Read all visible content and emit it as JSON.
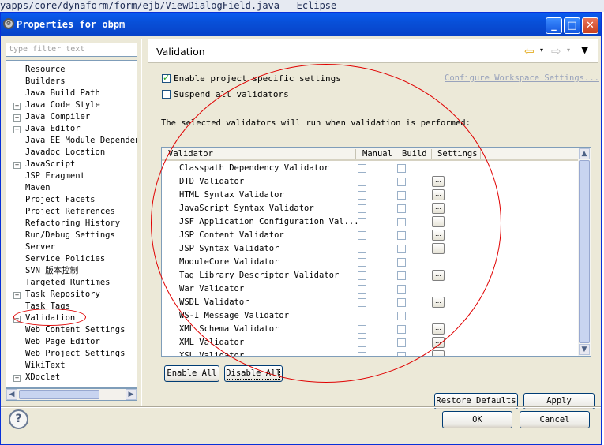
{
  "background_window": {
    "title": "yapps/core/dynaform/form/ejb/ViewDialogField.java - Eclipse"
  },
  "dialog": {
    "title": "Properties for obpm",
    "filter_placeholder": "type filter text",
    "tree": [
      {
        "label": "Resource",
        "expandable": false
      },
      {
        "label": "Builders",
        "expandable": false
      },
      {
        "label": "Java Build Path",
        "expandable": false
      },
      {
        "label": "Java Code Style",
        "expandable": true
      },
      {
        "label": "Java Compiler",
        "expandable": true
      },
      {
        "label": "Java Editor",
        "expandable": true
      },
      {
        "label": "Java EE Module Dependenc",
        "expandable": false
      },
      {
        "label": "Javadoc Location",
        "expandable": false
      },
      {
        "label": "JavaScript",
        "expandable": true
      },
      {
        "label": "JSP Fragment",
        "expandable": false
      },
      {
        "label": "Maven",
        "expandable": false
      },
      {
        "label": "Project Facets",
        "expandable": false
      },
      {
        "label": "Project References",
        "expandable": false
      },
      {
        "label": "Refactoring History",
        "expandable": false
      },
      {
        "label": "Run/Debug Settings",
        "expandable": false
      },
      {
        "label": "Server",
        "expandable": false
      },
      {
        "label": "Service Policies",
        "expandable": false
      },
      {
        "label": "SVN 版本控制",
        "expandable": false
      },
      {
        "label": "Targeted Runtimes",
        "expandable": false
      },
      {
        "label": "Task Repository",
        "expandable": true
      },
      {
        "label": "Task Tags",
        "expandable": false
      },
      {
        "label": "Validation",
        "expandable": true,
        "selected": true
      },
      {
        "label": "Web Content Settings",
        "expandable": false
      },
      {
        "label": "Web Page Editor",
        "expandable": false
      },
      {
        "label": "Web Project Settings",
        "expandable": false
      },
      {
        "label": "WikiText",
        "expandable": false
      },
      {
        "label": "XDoclet",
        "expandable": true
      }
    ],
    "page": {
      "title": "Validation",
      "enable_specific": {
        "label": "Enable project specific settings",
        "checked": true
      },
      "configure_link": "Configure Workspace Settings...",
      "suspend_all": {
        "label": "Suspend all validators",
        "checked": false
      },
      "info_text": "The selected validators will run when validation is performed:",
      "columns": [
        "Validator",
        "Manual",
        "Build",
        "Settings"
      ],
      "validators": [
        {
          "name": "Classpath Dependency Validator",
          "settings": false
        },
        {
          "name": "DTD Validator",
          "settings": true
        },
        {
          "name": "HTML Syntax Validator",
          "settings": true
        },
        {
          "name": "JavaScript Syntax Validator",
          "settings": true
        },
        {
          "name": "JSF Application Configuration Val...",
          "settings": true
        },
        {
          "name": "JSP Content Validator",
          "settings": true
        },
        {
          "name": "JSP Syntax Validator",
          "settings": true
        },
        {
          "name": "ModuleCore Validator",
          "settings": false
        },
        {
          "name": "Tag Library Descriptor Validator",
          "settings": true
        },
        {
          "name": "War Validator",
          "settings": false
        },
        {
          "name": "WSDL Validator",
          "settings": true
        },
        {
          "name": "WS-I Message Validator",
          "settings": false
        },
        {
          "name": "XML Schema Validator",
          "settings": true
        },
        {
          "name": "XML Validator",
          "settings": true
        },
        {
          "name": "XSL Validator",
          "settings": true
        }
      ],
      "enable_all": "Enable All",
      "disable_all": "Disable All",
      "restore_defaults": "Restore Defaults",
      "apply": "Apply"
    },
    "ok": "OK",
    "cancel": "Cancel"
  },
  "colors": {
    "title_blue": "#0850d8",
    "annotation_red": "#e00000",
    "dialog_bg": "#ece9d8"
  }
}
